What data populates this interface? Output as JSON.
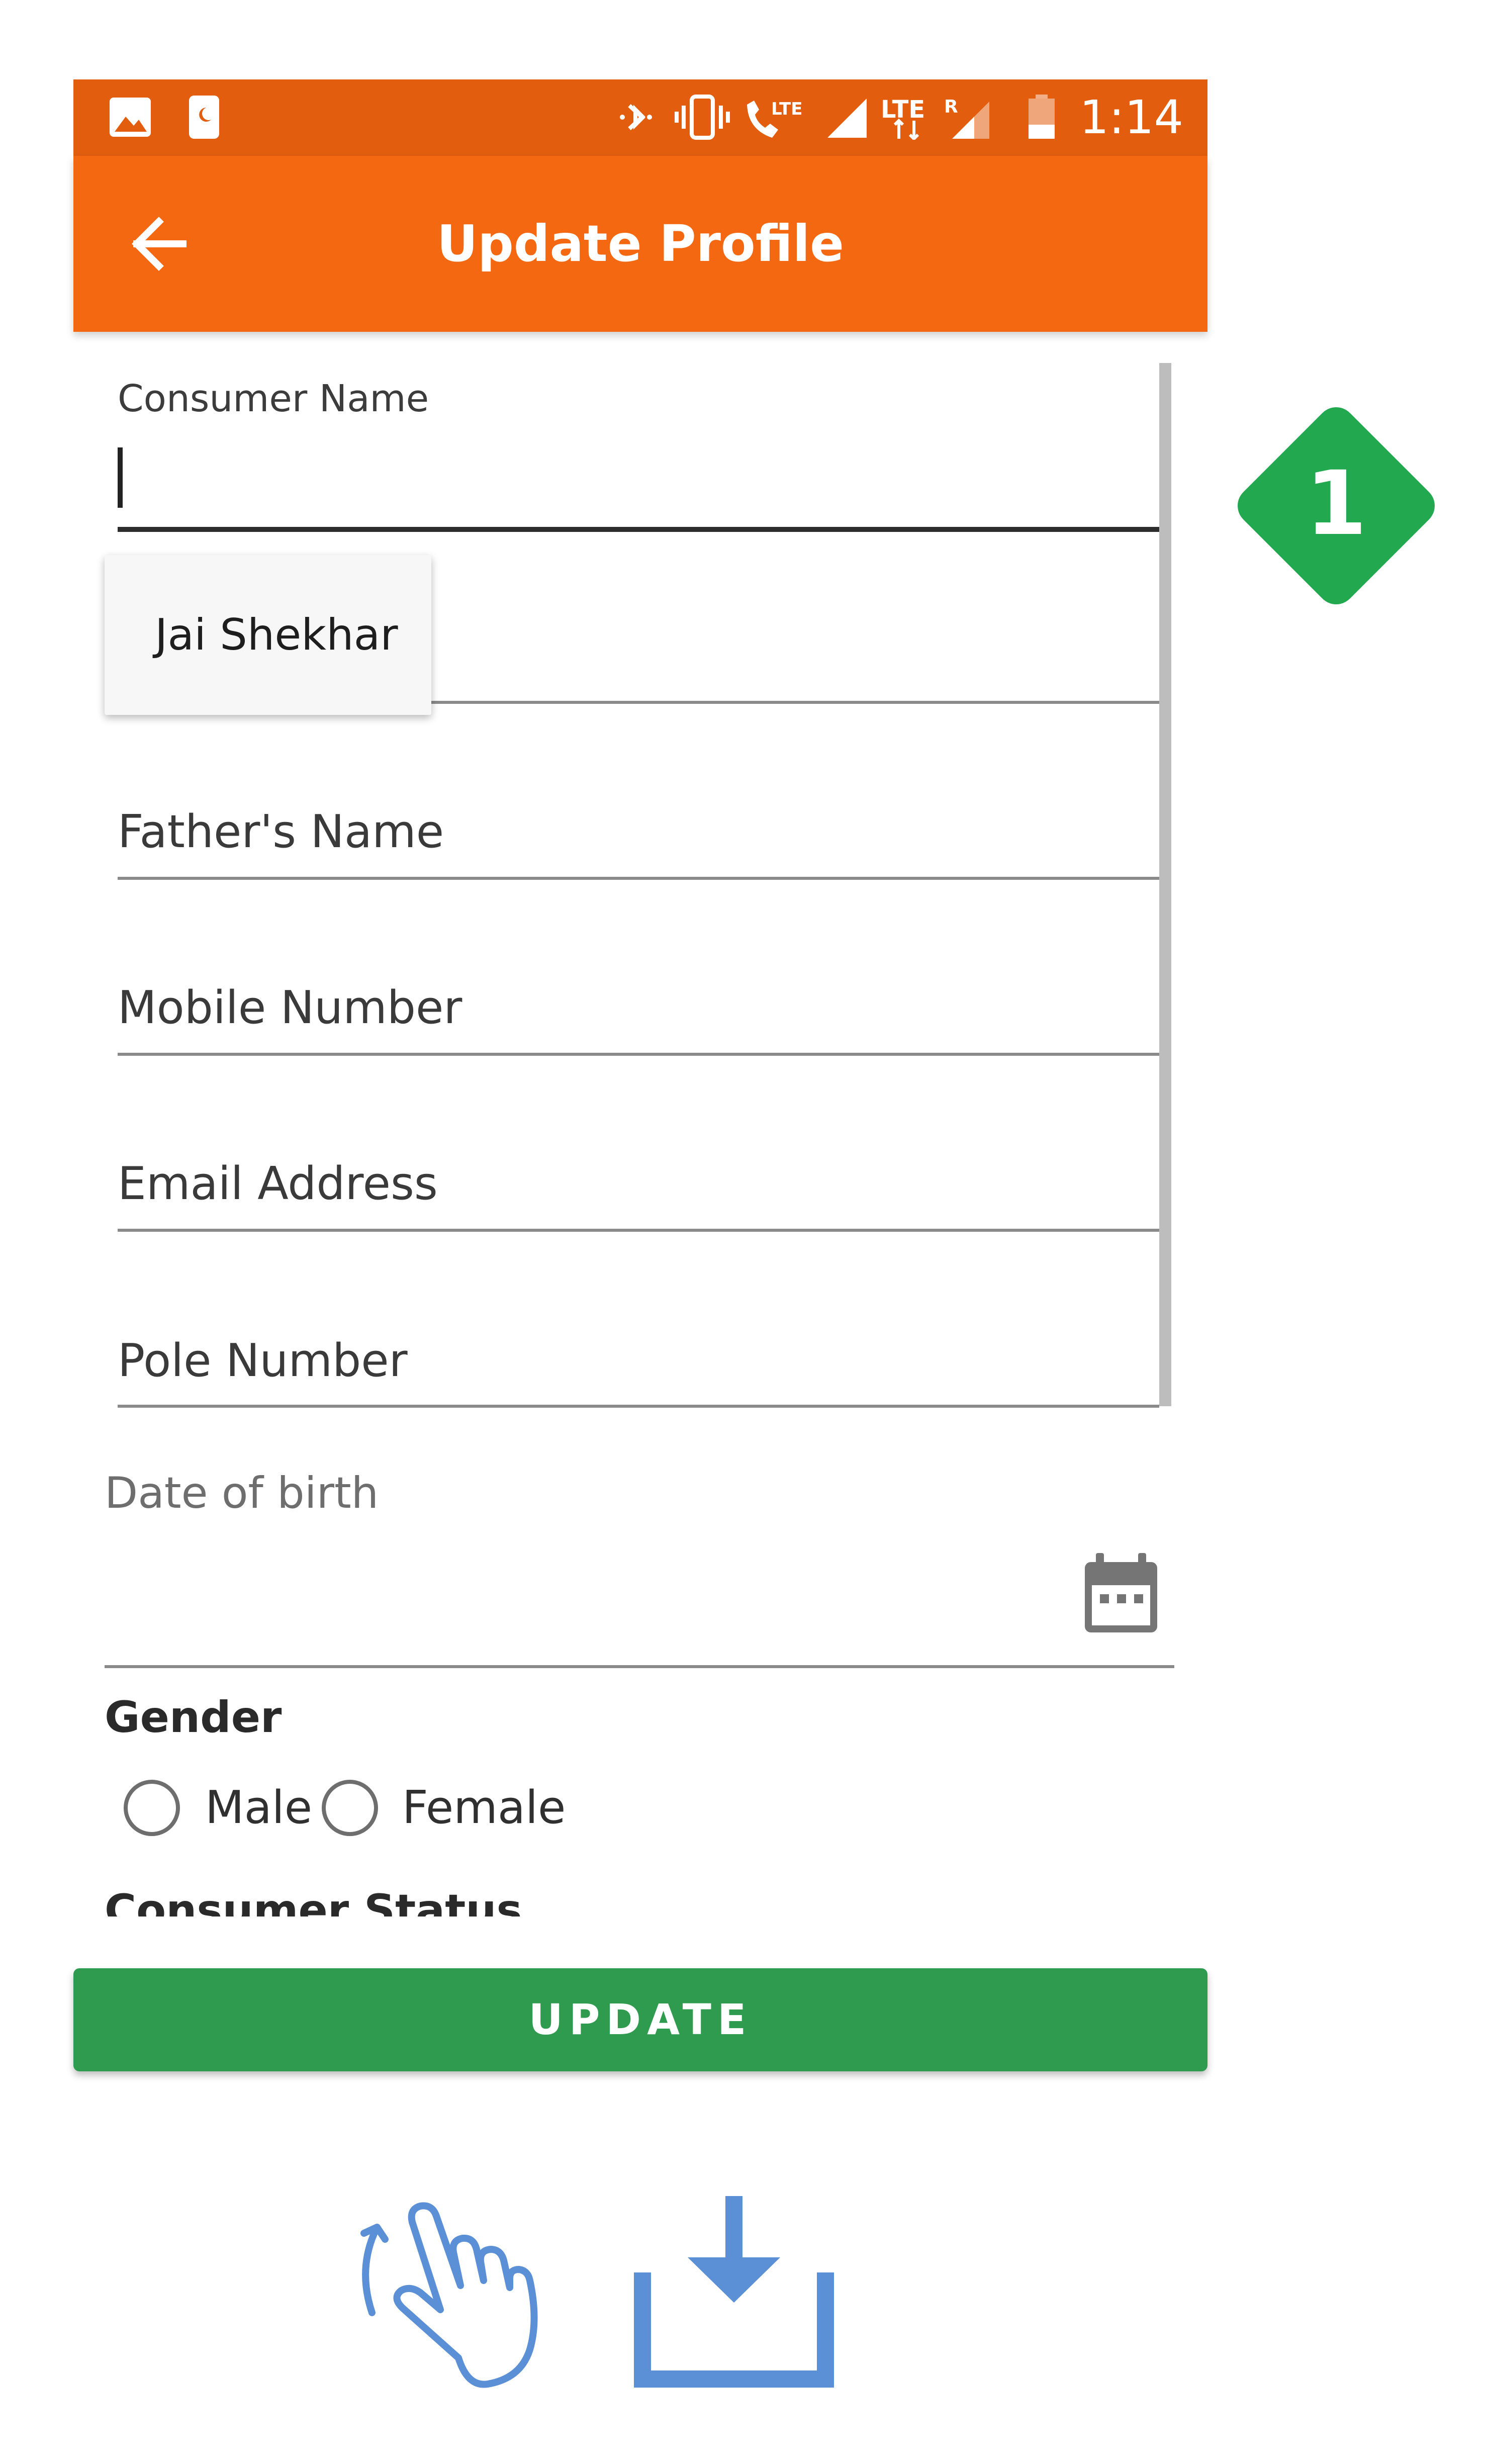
{
  "status_bar": {
    "time": "1:14",
    "icons": [
      "image-icon",
      "sim-toolkit-icon",
      "bluetooth-icon",
      "vibrate-icon",
      "volte-call-icon",
      "signal-icon",
      "lte-data-icon",
      "roaming-signal-icon",
      "battery-low-icon"
    ],
    "lte_label": "LTE",
    "roaming_label": "R"
  },
  "app_bar": {
    "title": "Update Profile",
    "back_icon": "arrow-left-icon"
  },
  "form": {
    "consumer_name": {
      "label": "Consumer Name",
      "value": ""
    },
    "autocomplete_suggestion": "Jai Shekhar",
    "fathers_name": {
      "placeholder": "Father's Name"
    },
    "mobile_number": {
      "placeholder": "Mobile Number"
    },
    "email_address": {
      "placeholder": "Email Address"
    },
    "pole_number": {
      "placeholder": "Pole Number"
    },
    "date_of_birth": {
      "label": "Date of birth",
      "icon": "calendar-icon"
    },
    "gender": {
      "label": "Gender",
      "options": [
        "Male",
        "Female"
      ]
    },
    "consumer_status_label": "Consumer Status"
  },
  "update_button": "UPDATE",
  "step_badge": "1",
  "overlay_icons": [
    "tap-gesture-icon",
    "download-icon"
  ],
  "colors": {
    "status_bar": "#e25d0e",
    "app_bar": "#f56812",
    "update_button": "#2f9b4e",
    "badge": "#22a94f",
    "overlay_icon": "#5b8fd6"
  }
}
